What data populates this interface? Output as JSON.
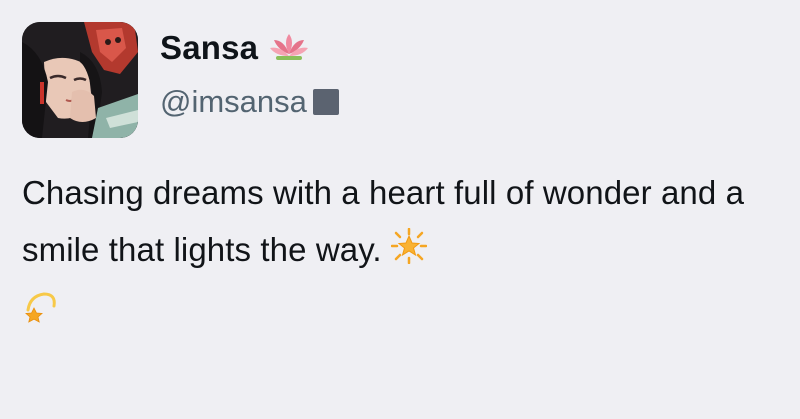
{
  "profile": {
    "display_name": "Sansa",
    "handle": "@imsansa",
    "name_icon": "lotus-icon",
    "handle_icon": "square-icon",
    "bio_text": "Chasing dreams with a heart full of wonder and a smile that lights the way.",
    "bio_emojis": [
      "glowing-star-icon",
      "dizzy-star-icon"
    ]
  },
  "colors": {
    "background": "#efeff3",
    "name": "#0f1419",
    "handle": "#536471",
    "lotus": "#e5738a",
    "star": "#f5a623"
  }
}
